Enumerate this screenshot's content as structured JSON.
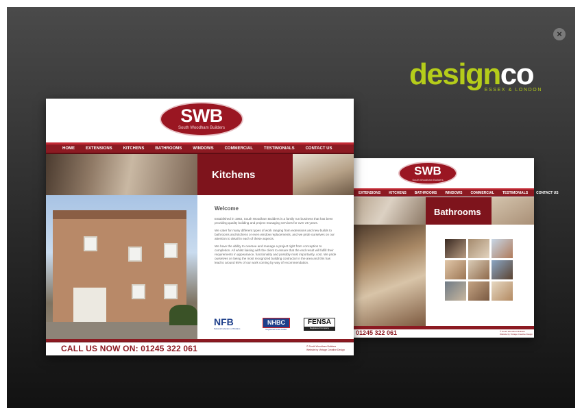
{
  "brand": {
    "word_part1": "design",
    "word_part2": "co",
    "tagline": "ESSEX & LONDON"
  },
  "close_symbol": "×",
  "front_page": {
    "logo": {
      "initials": "SWB",
      "name": "South Woodham Builders"
    },
    "nav": [
      "HOME",
      "EXTENSIONS",
      "KITCHENS",
      "BATHROOMS",
      "WINDOWS",
      "COMMERCIAL",
      "TESTIMONIALS",
      "CONTACT US"
    ],
    "page_title": "Kitchens",
    "welcome": "Welcome",
    "paragraphs": [
      "Established in 1983, South Woodham Builders is a family run business that has been providing quality building and project managing services for over 26 years.",
      "We cater for many different types of work ranging from extensions and new builds to bathrooms and kitchens or even window replacements, and we pride ourselves on our attention to detail in each of these aspects.",
      "We have the ability to oversee and manage a project right from conception to completion. All whilst liaising with the client to ensure that the end result will fulfill their requirements in appearance, functionality and possibly most importantly, cost. We pride ourselves on being the most recognized building contractor in the area and this has lead to around 95% of our work coming by way of recommendation."
    ],
    "accreditations": {
      "nfb": "NFB",
      "nfb_sub": "National Federation of Builders",
      "nhbc": "NHBC",
      "nhbc_sub": "Registered house builder",
      "fensa": "FENSA",
      "fensa_sub": "Registered Company"
    },
    "call": "CALL US NOW ON: 01245 322 061",
    "footer_line1": "© South Woodham Builders",
    "footer_line2": "Website by Vintage Creative Design"
  },
  "back_page": {
    "logo": {
      "initials": "SWB",
      "name": "South Woodham Builders"
    },
    "nav": [
      "EXTENSIONS",
      "KITCHENS",
      "BATHROOMS",
      "WINDOWS",
      "COMMERCIAL",
      "TESTIMONIALS",
      "CONTACT US"
    ],
    "page_title": "Bathrooms",
    "call": "01245 322 061",
    "footer_line1": "© South Woodham Builders",
    "footer_line2": "Website by Vintage Creative Design"
  },
  "colors": {
    "brand_lime": "#b5cc1a",
    "swb_red": "#8c1a22",
    "swb_dark_red": "#7e141c"
  }
}
